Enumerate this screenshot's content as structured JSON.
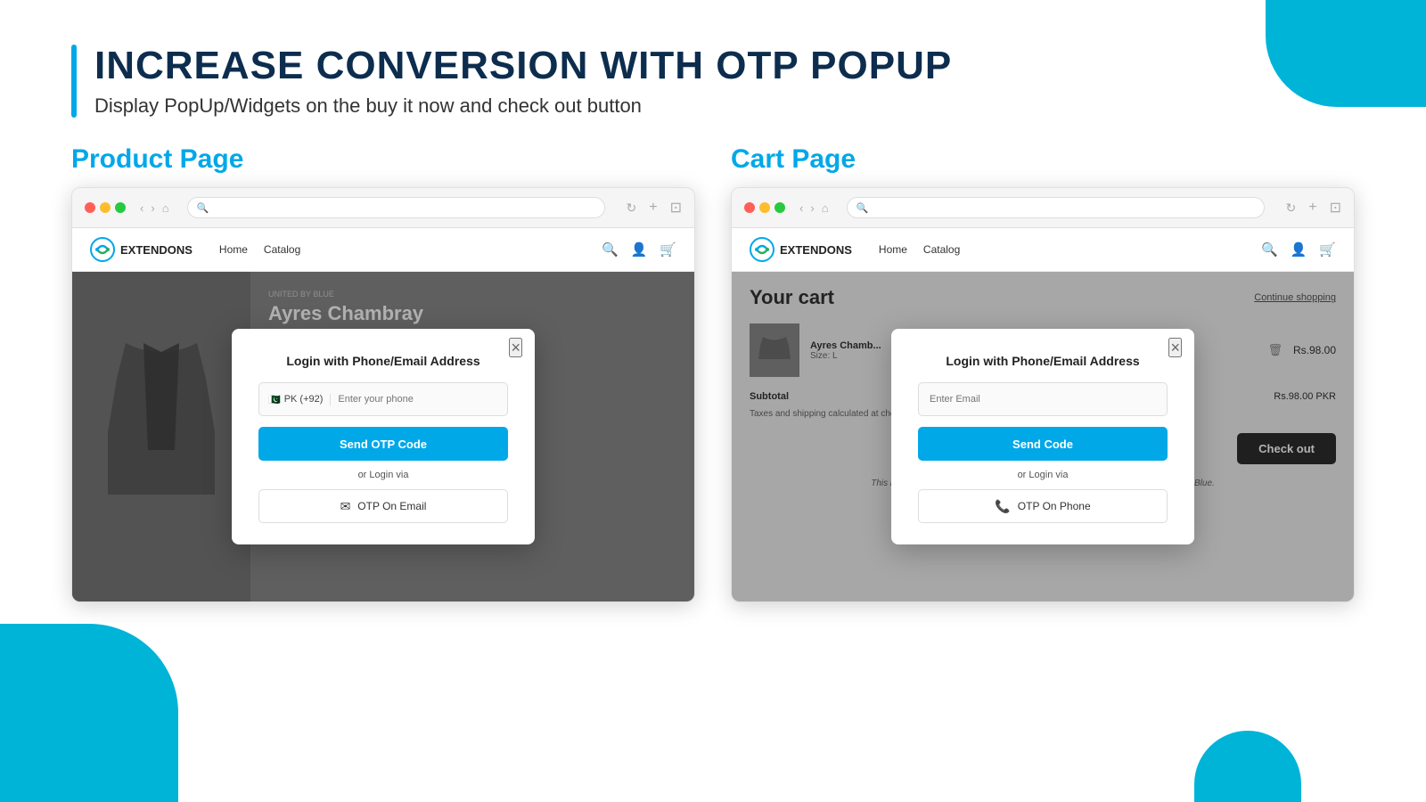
{
  "header": {
    "title": "INCREASE CONVERSION WITH OTP POPUP",
    "subtitle": "Display PopUp/Widgets on the buy it now and check out button"
  },
  "sections": {
    "product_page": {
      "label": "Product Page",
      "browser": {
        "store_name": "EXTENDONS",
        "nav_links": [
          "Home",
          "Catalog"
        ],
        "brand": "UNITED BY BLUE",
        "product_name": "Ayres Chambray",
        "popup": {
          "title": "Login with Phone/Email Address",
          "phone_placeholder": "Enter your phone",
          "phone_code": "PK (+92)",
          "send_btn": "Send OTP Code",
          "or_text": "or Login via",
          "alt_btn": "OTP On Email",
          "close": "×"
        }
      }
    },
    "cart_page": {
      "label": "Cart Page",
      "browser": {
        "store_name": "EXTENDONS",
        "nav_links": [
          "Home",
          "Catalog"
        ],
        "cart_title": "Your cart",
        "continue_shopping": "Continue shopping",
        "item_name": "Ayres Chamb...",
        "item_size": "Size: L",
        "item_price": "Rs.98.00",
        "subtotal_label": "Subtotal",
        "subtotal_value": "Rs.98.00 PKR",
        "subtotal_note": "Taxes and shipping calculated at checkout",
        "checkout_btn": "Check out",
        "popup": {
          "title": "Login with Phone/Email Address",
          "email_placeholder": "Enter Email",
          "send_btn": "Send Code",
          "or_text": "or Login via",
          "alt_btn": "OTP On Phone",
          "close": "×"
        },
        "demo_text": "This is a demonstration store. You can purchase products like this from United By Blue."
      }
    }
  },
  "colors": {
    "accent_blue": "#00a8e8",
    "dark_navy": "#0d2d4e",
    "dark_checkout": "#2d2d2d"
  }
}
